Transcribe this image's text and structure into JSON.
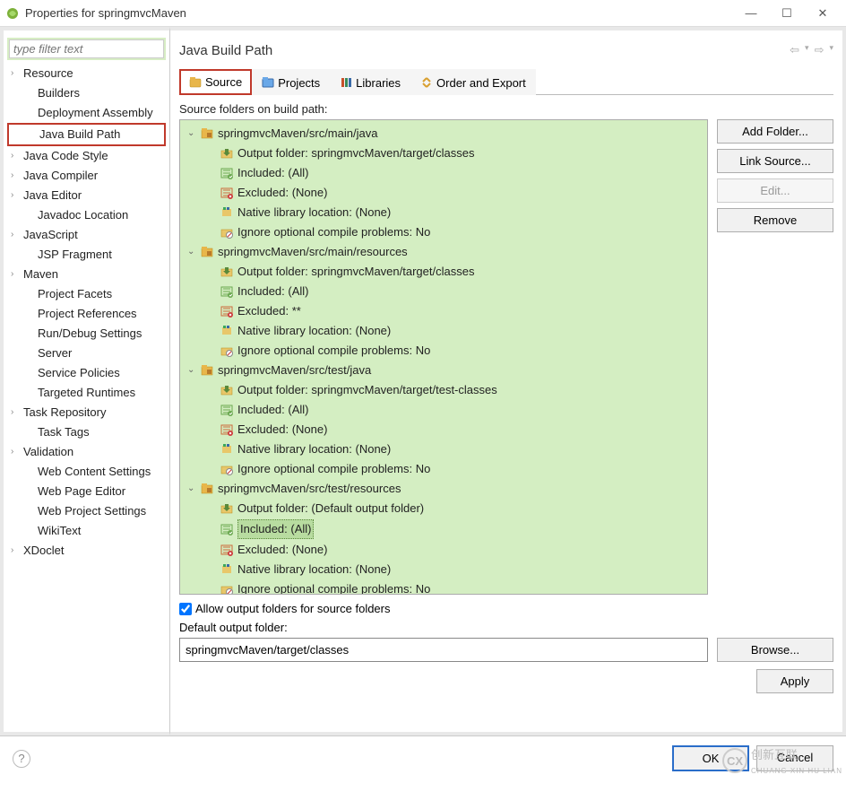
{
  "window": {
    "title": "Properties for springmvcMaven",
    "filter_placeholder": "type filter text"
  },
  "sidebar": {
    "items": [
      {
        "label": "Resource",
        "expandable": true,
        "sub": false
      },
      {
        "label": "Builders",
        "expandable": false,
        "sub": true
      },
      {
        "label": "Deployment Assembly",
        "expandable": false,
        "sub": true
      },
      {
        "label": "Java Build Path",
        "expandable": false,
        "sub": true,
        "highlighted": true
      },
      {
        "label": "Java Code Style",
        "expandable": true,
        "sub": false
      },
      {
        "label": "Java Compiler",
        "expandable": true,
        "sub": false
      },
      {
        "label": "Java Editor",
        "expandable": true,
        "sub": false
      },
      {
        "label": "Javadoc Location",
        "expandable": false,
        "sub": true
      },
      {
        "label": "JavaScript",
        "expandable": true,
        "sub": false
      },
      {
        "label": "JSP Fragment",
        "expandable": false,
        "sub": true
      },
      {
        "label": "Maven",
        "expandable": true,
        "sub": false
      },
      {
        "label": "Project Facets",
        "expandable": false,
        "sub": true
      },
      {
        "label": "Project References",
        "expandable": false,
        "sub": true
      },
      {
        "label": "Run/Debug Settings",
        "expandable": false,
        "sub": true
      },
      {
        "label": "Server",
        "expandable": false,
        "sub": true
      },
      {
        "label": "Service Policies",
        "expandable": false,
        "sub": true
      },
      {
        "label": "Targeted Runtimes",
        "expandable": false,
        "sub": true
      },
      {
        "label": "Task Repository",
        "expandable": true,
        "sub": false
      },
      {
        "label": "Task Tags",
        "expandable": false,
        "sub": true
      },
      {
        "label": "Validation",
        "expandable": true,
        "sub": false
      },
      {
        "label": "Web Content Settings",
        "expandable": false,
        "sub": true
      },
      {
        "label": "Web Page Editor",
        "expandable": false,
        "sub": true
      },
      {
        "label": "Web Project Settings",
        "expandable": false,
        "sub": true
      },
      {
        "label": "WikiText",
        "expandable": false,
        "sub": true
      },
      {
        "label": "XDoclet",
        "expandable": true,
        "sub": false
      }
    ]
  },
  "page": {
    "title": "Java Build Path",
    "tabs": [
      "Source",
      "Projects",
      "Libraries",
      "Order and Export"
    ],
    "active_tab": 0,
    "intro": "Source folders on build path:",
    "actions": {
      "add_folder": "Add Folder...",
      "link_source": "Link Source...",
      "edit": "Edit...",
      "remove": "Remove"
    },
    "allow_output": "Allow output folders for source folders",
    "default_label": "Default output folder:",
    "default_value": "springmvcMaven/target/classes",
    "browse": "Browse...",
    "apply": "Apply"
  },
  "source_folders": [
    {
      "path": "springmvcMaven/src/main/java",
      "children": [
        {
          "kind": "output",
          "label": "Output folder: springmvcMaven/target/classes"
        },
        {
          "kind": "include",
          "label": "Included: (All)"
        },
        {
          "kind": "exclude",
          "label": "Excluded: (None)"
        },
        {
          "kind": "native",
          "label": "Native library location: (None)"
        },
        {
          "kind": "ignore",
          "label": "Ignore optional compile problems: No"
        }
      ]
    },
    {
      "path": "springmvcMaven/src/main/resources",
      "children": [
        {
          "kind": "output",
          "label": "Output folder: springmvcMaven/target/classes"
        },
        {
          "kind": "include",
          "label": "Included: (All)"
        },
        {
          "kind": "exclude",
          "label": "Excluded: **"
        },
        {
          "kind": "native",
          "label": "Native library location: (None)"
        },
        {
          "kind": "ignore",
          "label": "Ignore optional compile problems: No"
        }
      ]
    },
    {
      "path": "springmvcMaven/src/test/java",
      "children": [
        {
          "kind": "output",
          "label": "Output folder: springmvcMaven/target/test-classes"
        },
        {
          "kind": "include",
          "label": "Included: (All)"
        },
        {
          "kind": "exclude",
          "label": "Excluded: (None)"
        },
        {
          "kind": "native",
          "label": "Native library location: (None)"
        },
        {
          "kind": "ignore",
          "label": "Ignore optional compile problems: No"
        }
      ]
    },
    {
      "path": "springmvcMaven/src/test/resources",
      "children": [
        {
          "kind": "output",
          "label": "Output folder: (Default output folder)"
        },
        {
          "kind": "include",
          "label": "Included: (All)",
          "selected": true
        },
        {
          "kind": "exclude",
          "label": "Excluded: (None)"
        },
        {
          "kind": "native",
          "label": "Native library location: (None)"
        },
        {
          "kind": "ignore",
          "label": "Ignore optional compile problems: No"
        }
      ]
    }
  ],
  "footer": {
    "ok": "OK",
    "cancel": "Cancel"
  },
  "watermark": "创新互联"
}
